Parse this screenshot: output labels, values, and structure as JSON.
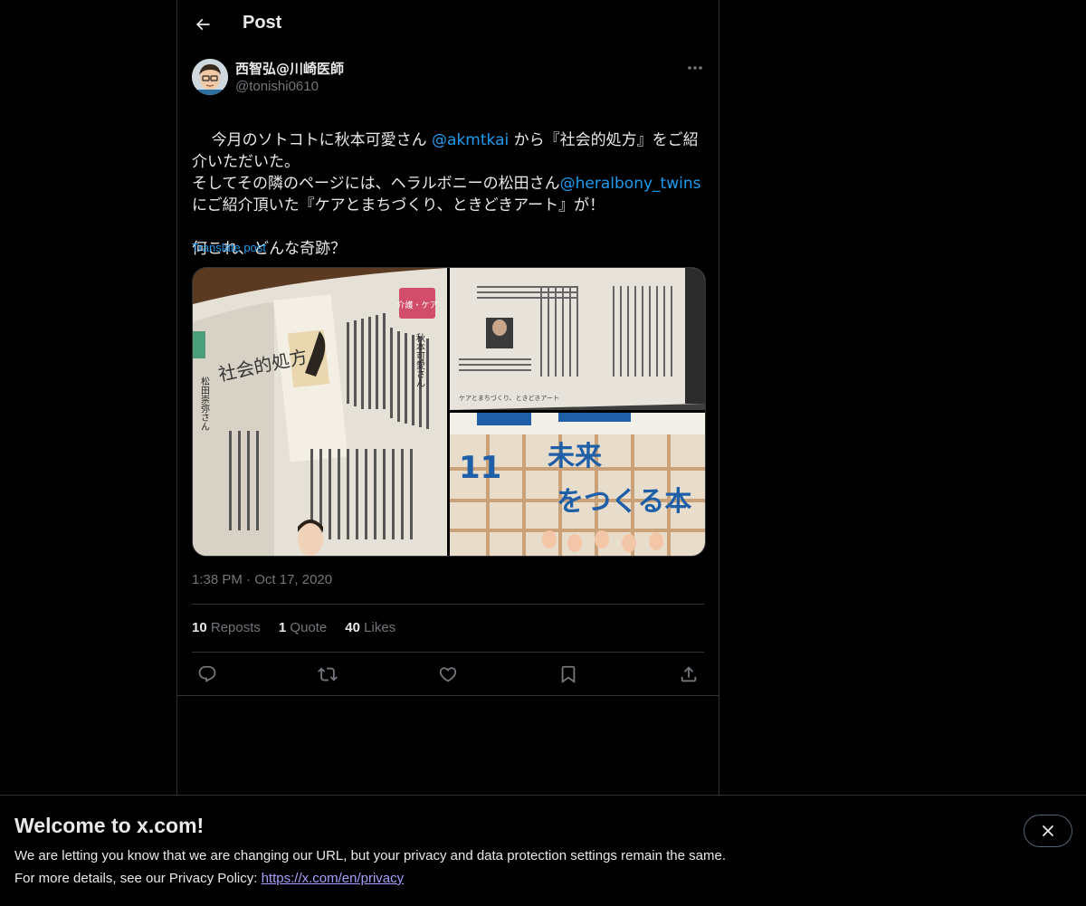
{
  "header": {
    "title": "Post"
  },
  "author": {
    "display_name": "西智弘@川崎医師",
    "handle": "@tonishi0610"
  },
  "post": {
    "segments": [
      {
        "text": "今月のソトコトに秋本可愛さん ",
        "mention": false
      },
      {
        "text": "@akmtkai",
        "mention": true
      },
      {
        "text": " から『社会的処方』をご紹介いただいた。\nそしてその隣のページには、ヘラルボニーの松田さん",
        "mention": false
      },
      {
        "text": "@heralbony_twins",
        "mention": true
      },
      {
        "text": "\nにご紹介頂いた『ケアとまちづくり、ときどきアート』が！\n\n何これ、どんな奇跡？",
        "mention": false
      }
    ],
    "translate_label": "Translate post",
    "time": "1:38 PM",
    "separator": "·",
    "date": "Oct 17, 2020"
  },
  "media": {
    "photos": [
      {
        "name": "magazine-page-social-prescription",
        "title_vertical": "社会的処方",
        "caption": "秋本可愛さん",
        "badge": "介護・ケア",
        "side_text": "松田崇弥さん"
      },
      {
        "name": "magazine-page-care-and-town",
        "caption": "ケアとまちづくり、ときどきアート"
      },
      {
        "name": "magazine-cover-sotokoto",
        "issue": "11",
        "headline_line1": "未来",
        "headline_line2": "をつくる本"
      }
    ]
  },
  "stats": {
    "reposts": {
      "count": "10",
      "label": "Reposts"
    },
    "quotes": {
      "count": "1",
      "label": "Quote"
    },
    "likes": {
      "count": "40",
      "label": "Likes"
    }
  },
  "actions": [
    "reply-icon",
    "repost-icon",
    "like-icon",
    "bookmark-icon",
    "share-icon"
  ],
  "banner": {
    "title": "Welcome to x.com!",
    "line1": "We are letting you know that we are changing our URL, but your privacy and data protection settings remain the same.",
    "line2_prefix": "For more details, see our Privacy Policy: ",
    "link": "https://x.com/en/privacy"
  },
  "colors": {
    "accent": "#1d9bf0",
    "background": "#000000",
    "muted": "#71767b",
    "link_banner": "#a6a0ff"
  }
}
